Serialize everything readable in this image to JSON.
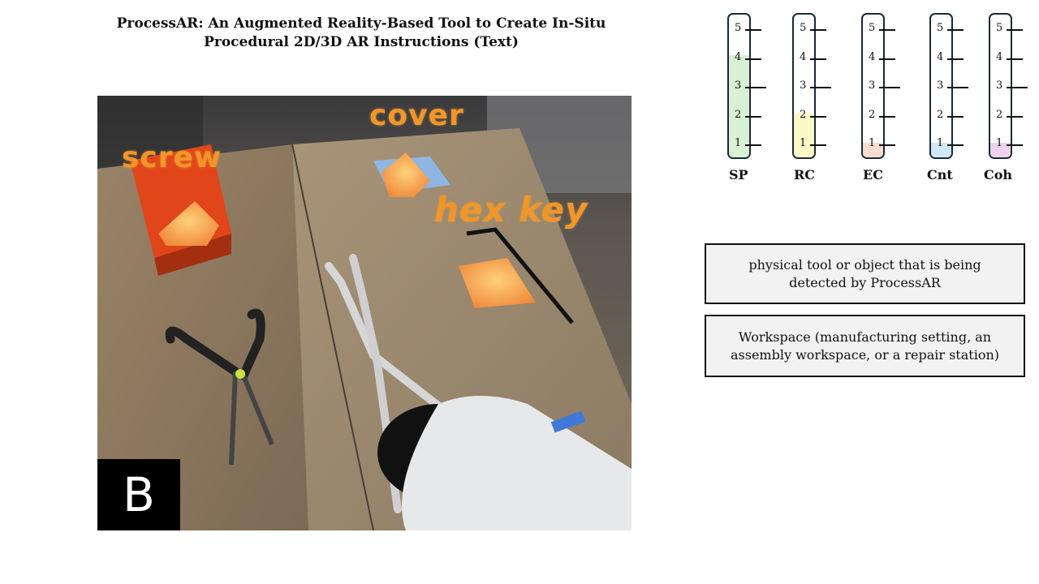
{
  "title": {
    "line1": "ProcessAR: An Augmented Reality-Based Tool to Create In-Situ",
    "line2": "Procedural 2D/3D AR Instructions (Text)"
  },
  "scene": {
    "labels": {
      "screw": "screw",
      "cover": "cover",
      "hex_key": "hex key"
    },
    "badge": "B"
  },
  "scales": [
    {
      "name": "SP",
      "level": 4,
      "color": "#d8f0d4"
    },
    {
      "name": "RC",
      "level": 2,
      "color": "#fbf8c8"
    },
    {
      "name": "EC",
      "level": 1,
      "color": "#f8dccf"
    },
    {
      "name": "Cnt",
      "level": 1,
      "color": "#cfe8f6"
    },
    {
      "name": "Coh",
      "level": 1,
      "color": "#f0d2ee"
    }
  ],
  "tick_labels": [
    "1",
    "2",
    "3",
    "4",
    "5"
  ],
  "legend": {
    "object_box": "physical tool or object that is being detected by ProcessAR",
    "workspace_box": "Workspace (manufacturing setting, an assembly workspace, or a repair station)"
  }
}
